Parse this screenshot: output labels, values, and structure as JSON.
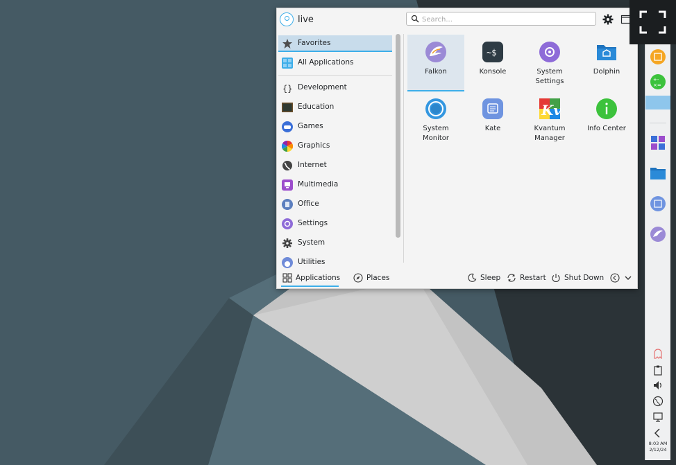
{
  "user": {
    "name": "live"
  },
  "search": {
    "placeholder": "Search..."
  },
  "categories": [
    {
      "label": "Favorites",
      "icon": "star-icon"
    },
    {
      "label": "All Applications",
      "icon": "grid-apps-icon"
    },
    {
      "label": "Development",
      "icon": "braces-icon"
    },
    {
      "label": "Education",
      "icon": "chalkboard-icon"
    },
    {
      "label": "Games",
      "icon": "gamepad-icon"
    },
    {
      "label": "Graphics",
      "icon": "color-wheel-icon"
    },
    {
      "label": "Internet",
      "icon": "globe-icon"
    },
    {
      "label": "Multimedia",
      "icon": "media-icon"
    },
    {
      "label": "Office",
      "icon": "office-icon"
    },
    {
      "label": "Settings",
      "icon": "settings-icon"
    },
    {
      "label": "System",
      "icon": "gear-icon"
    },
    {
      "label": "Utilities",
      "icon": "utilities-icon"
    }
  ],
  "apps": [
    {
      "name": "Falkon",
      "icon": "falkon-icon"
    },
    {
      "name": "Konsole",
      "icon": "terminal-icon"
    },
    {
      "name": "System\nSettings",
      "icon": "system-settings-icon"
    },
    {
      "name": "Dolphin",
      "icon": "folder-icon"
    },
    {
      "name": "System\nMonitor",
      "icon": "system-monitor-icon"
    },
    {
      "name": "Kate",
      "icon": "kate-icon"
    },
    {
      "name": "Kvantum\nManager",
      "icon": "kvantum-icon"
    },
    {
      "name": "Info Center",
      "icon": "info-icon"
    }
  ],
  "footer": {
    "applications": "Applications",
    "places": "Places",
    "sleep": "Sleep",
    "restart": "Restart",
    "shutdown": "Shut Down"
  },
  "tray": {
    "time": "8:03 AM",
    "date": "2/12/24"
  },
  "colors": {
    "accent": "#3daee9",
    "selection": "#c8dceb",
    "panel": "#eff0f1"
  }
}
